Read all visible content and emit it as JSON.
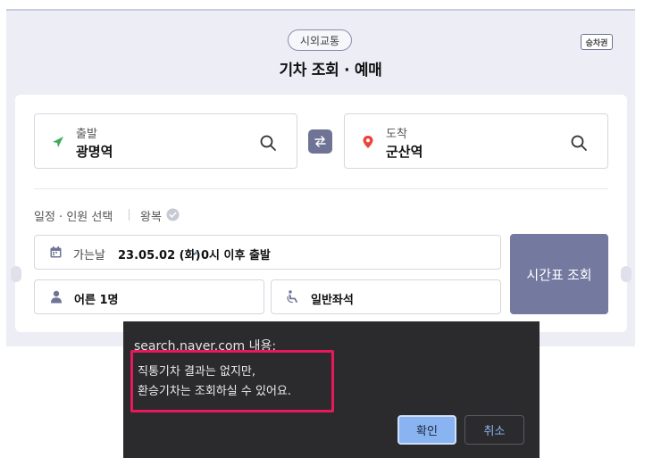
{
  "header": {
    "category_pill": "시외교통",
    "ticket_badge": "승차권",
    "title": "기차 조회 · 예매"
  },
  "departure": {
    "label": "출발",
    "station": "광명역"
  },
  "arrival": {
    "label": "도착",
    "station": "군산역"
  },
  "schedule": {
    "label": "일정 · 인원 선택",
    "roundtrip": "왕복"
  },
  "date_field": {
    "label": "가는날",
    "date": "23.05.02 (화)",
    "dot": "•",
    "time": "0시 이후 출발"
  },
  "passengers": "어른 1명",
  "seat_type": "일반좌석",
  "timetable_button": "시간표 조회",
  "dialog": {
    "title": "search.naver.com 내용:",
    "message": "직통기차 결과는 없지만,\n환승기차는 조회하실 수 있어요.",
    "ok": "확인",
    "cancel": "취소"
  },
  "colors": {
    "accent": "#7479a0",
    "departure_marker": "#3dac5a",
    "arrival_marker": "#e8453c",
    "dialog_highlight": "#e8185a"
  }
}
